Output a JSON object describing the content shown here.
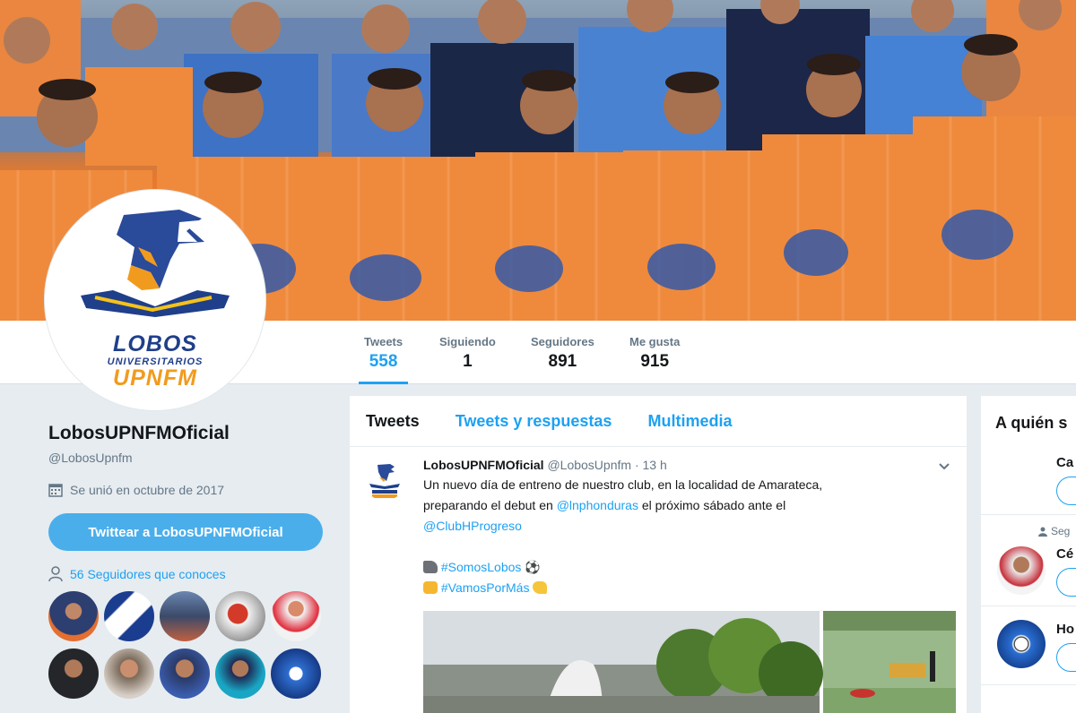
{
  "profile": {
    "display_name": "LobosUPNFMOficial",
    "handle": "@LobosUpnfm",
    "joined": "Se unió en octubre de 2017",
    "tweet_button": "Twittear a LobosUPNFMOficial",
    "followers_you_know": "56 Seguidores que conoces",
    "logo_line1": "LOBOS",
    "logo_line2": "UNIVERSITARIOS",
    "logo_line3": "UPNFM"
  },
  "stats": [
    {
      "label": "Tweets",
      "value": "558"
    },
    {
      "label": "Siguiendo",
      "value": "1"
    },
    {
      "label": "Seguidores",
      "value": "891"
    },
    {
      "label": "Me gusta",
      "value": "915"
    }
  ],
  "tabs": [
    "Tweets",
    "Tweets y respuestas",
    "Multimedia"
  ],
  "tweet": {
    "name": "LobosUPNFMOficial",
    "handle": "@LobosUpnfm",
    "time": "· 13 h",
    "line1": "Un nuevo día de entreno de nuestro club, en la localidad de Amarateca,",
    "line2_pre": "preparando el debut en ",
    "line2_mention": "@lnphonduras",
    "line2_post": " el próximo sábado ante el",
    "line3_mention": "@ClubHProgreso",
    "hashtag1": "#SomosLobos",
    "hashtag2": "#VamosPorMás"
  },
  "sidebar_right": {
    "title": "A quién s",
    "row1": "Ca",
    "row2_small": "Seg",
    "row2": "Cé",
    "row3": "Ho"
  },
  "colors": {
    "accent": "#1da1f2",
    "button": "#4aaeeb",
    "brand_blue": "#1f3f8a",
    "brand_orange": "#f19b1e"
  }
}
